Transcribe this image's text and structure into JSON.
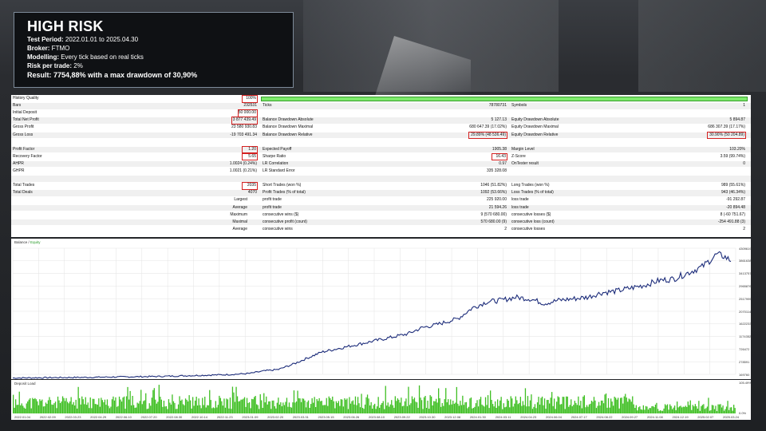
{
  "info": {
    "title": "HIGH RISK",
    "rows": [
      {
        "key": "Test Period:",
        "value": " 2022.01.01 to 2025.04.30"
      },
      {
        "key": "Broker:",
        "value": " FTMO"
      },
      {
        "key": "Modelling:",
        "value": " Every tick based on real ticks"
      },
      {
        "key": "Risk per trade:",
        "value": " 2%"
      }
    ],
    "result_key": "Result:",
    "result_value": " 7754,88% with a max drawdown of 30,90%"
  },
  "report": {
    "rows": [
      {
        "cells": [
          [
            "History Quality",
            "100%"
          ],
          [
            "",
            ""
          ],
          [
            "",
            ""
          ]
        ],
        "green": true
      },
      {
        "cells": [
          [
            "Bars",
            "232531"
          ],
          [
            "Ticks",
            "78780731"
          ],
          [
            "Symbols",
            "1"
          ]
        ]
      },
      {
        "cells": [
          [
            "Initial Deposit",
            "50 000.00"
          ],
          [
            "",
            ""
          ],
          [
            "",
            ""
          ]
        ]
      },
      {
        "cells": [
          [
            "Total Net Profit",
            "3 877 439.49"
          ],
          [
            "Balance Drawdown Absolute",
            "5 127.13"
          ],
          [
            "Equity Drawdown Absolute",
            "5 894.87"
          ]
        ]
      },
      {
        "cells": [
          [
            "Gross Profit",
            "23 580 930.83"
          ],
          [
            "Balance Drawdown Maximal",
            "680 647.39 (17.02%)"
          ],
          [
            "Equity Drawdown Maximal",
            "686 307.39 (17.17%)"
          ]
        ]
      },
      {
        "cells": [
          [
            "Gross Loss",
            "-19 703 491.34"
          ],
          [
            "Balance Drawdown Relative",
            "29.89% (48 536.49)"
          ],
          [
            "Equity Drawdown Relative",
            "30.90% (50 204.89)"
          ]
        ]
      },
      {
        "cells": [
          [
            "",
            ""
          ],
          [
            "",
            ""
          ],
          [
            "",
            ""
          ]
        ]
      },
      {
        "cells": [
          [
            "Profit Factor",
            "1.20"
          ],
          [
            "Expected Payoff",
            "1905.38"
          ],
          [
            "Margin Level",
            "103.20%"
          ]
        ]
      },
      {
        "cells": [
          [
            "Recovery Factor",
            "5.65"
          ],
          [
            "Sharpe Ratio",
            "16.43"
          ],
          [
            "Z-Score",
            "3.59 (99.74%)"
          ]
        ]
      },
      {
        "cells": [
          [
            "AHPR",
            "1.0024 (0.24%)"
          ],
          [
            "LR Correlation",
            "0.97"
          ],
          [
            "OnTester result",
            "0"
          ]
        ]
      },
      {
        "cells": [
          [
            "GHPR",
            "1.0021 (0.21%)"
          ],
          [
            "LR Standard Error",
            "335 328.08"
          ],
          [
            "",
            ""
          ]
        ]
      },
      {
        "cells": [
          [
            "",
            ""
          ],
          [
            "",
            ""
          ],
          [
            "",
            ""
          ]
        ]
      },
      {
        "cells": [
          [
            "Total Trades",
            "2035"
          ],
          [
            "Short Trades (won %)",
            "1046 (51.82%)"
          ],
          [
            "Long Trades (won %)",
            "989 (55.61%)"
          ]
        ]
      },
      {
        "cells": [
          [
            "Total Deals",
            "4070"
          ],
          [
            "Profit Trades (% of total)",
            "1092 (53.66%)"
          ],
          [
            "Loss Trades (% of total)",
            "943 (46.34%)"
          ]
        ]
      },
      {
        "cells": [
          [
            "Largest",
            ""
          ],
          [
            "profit trade",
            "225 920.00"
          ],
          [
            "loss trade",
            "-91 292.87"
          ]
        ],
        "rightlabel": true
      },
      {
        "cells": [
          [
            "Average",
            ""
          ],
          [
            "profit trade",
            "21 594.26"
          ],
          [
            "loss trade",
            "-20 894.48"
          ]
        ],
        "rightlabel": true
      },
      {
        "cells": [
          [
            "Maximum",
            ""
          ],
          [
            "consecutive wins ($)",
            "9 (570 680.00)"
          ],
          [
            "consecutive losses ($)",
            "8 (-60 751.67)"
          ]
        ],
        "rightlabel": true
      },
      {
        "cells": [
          [
            "Maximal",
            ""
          ],
          [
            "consecutive profit (count)",
            "570 680.00 (9)"
          ],
          [
            "consecutive loss (count)",
            "-254 491.88 (3)"
          ]
        ],
        "rightlabel": true
      },
      {
        "cells": [
          [
            "Average",
            ""
          ],
          [
            "consecutive wins",
            "2"
          ],
          [
            "consecutive losses",
            "2"
          ]
        ],
        "rightlabel": true
      }
    ],
    "highlight": [
      "100%",
      "50 000.00",
      "3 877 439.49",
      "1.20",
      "5.65",
      "2035",
      "29.89% (48 536.49)",
      "16.43",
      "30.90% (50 204.89)"
    ]
  },
  "chart": {
    "label_balance": "Balance",
    "label_sep": " / ",
    "label_equity": "Equity",
    "yticks": [
      "4309619",
      "3861638",
      "3413757",
      "2965876",
      "2517995",
      "2070114",
      "1622233",
      "1174352",
      "726472",
      "278591",
      "169760"
    ],
    "ymin": 169760,
    "ymax": 4309619,
    "xticks": [
      "2022.01.04",
      "2022.02.09",
      "2022.03.23",
      "2022.04.29",
      "2022.06.10",
      "2022.07.20",
      "2022.08.30",
      "2022.10.14",
      "2022.11.23",
      "2023.01.09",
      "2023.02.20",
      "2023.03.31",
      "2023.05.15",
      "2023.06.26",
      "2023.08.10",
      "2023.09.22",
      "2023.10.30",
      "2023.12.08",
      "2024.01.30",
      "2024.03.11",
      "2024.04.23",
      "2024.06.04",
      "2024.07.17",
      "2024.08.22",
      "2024.09.27",
      "2024.11.08",
      "2024.12.19",
      "2025.02.07",
      "2025.03.24"
    ],
    "balance_path": [
      [
        0,
        50000
      ],
      [
        0.05,
        60000
      ],
      [
        0.1,
        70000
      ],
      [
        0.15,
        85000
      ],
      [
        0.2,
        100000
      ],
      [
        0.25,
        130000
      ],
      [
        0.3,
        160000
      ],
      [
        0.33,
        200000
      ],
      [
        0.35,
        280000
      ],
      [
        0.37,
        330000
      ],
      [
        0.39,
        500000
      ],
      [
        0.41,
        700000
      ],
      [
        0.43,
        900000
      ],
      [
        0.45,
        1000000
      ],
      [
        0.48,
        1150000
      ],
      [
        0.5,
        1250000
      ],
      [
        0.53,
        1400000
      ],
      [
        0.55,
        1500000
      ],
      [
        0.57,
        1700000
      ],
      [
        0.59,
        1800000
      ],
      [
        0.62,
        2000000
      ],
      [
        0.64,
        2350000
      ],
      [
        0.66,
        2550000
      ],
      [
        0.68,
        2600000
      ],
      [
        0.7,
        2700000
      ],
      [
        0.72,
        2650000
      ],
      [
        0.74,
        2500000
      ],
      [
        0.76,
        2600000
      ],
      [
        0.78,
        2650000
      ],
      [
        0.8,
        2700000
      ],
      [
        0.82,
        2850000
      ],
      [
        0.84,
        2900000
      ],
      [
        0.86,
        3000000
      ],
      [
        0.88,
        3100000
      ],
      [
        0.9,
        3250000
      ],
      [
        0.92,
        3300000
      ],
      [
        0.94,
        3500000
      ],
      [
        0.96,
        3700000
      ],
      [
        0.97,
        3900000
      ],
      [
        0.98,
        4100000
      ],
      [
        0.99,
        4050000
      ],
      [
        1,
        3900000
      ]
    ],
    "deposit_ticks": [
      "105.49%",
      "0.0%"
    ],
    "deposit_label": "Deposit Load",
    "colors": {
      "balance": "#1c2c7a",
      "load": "#3fbf23",
      "grid": "#e3e3e3"
    }
  }
}
